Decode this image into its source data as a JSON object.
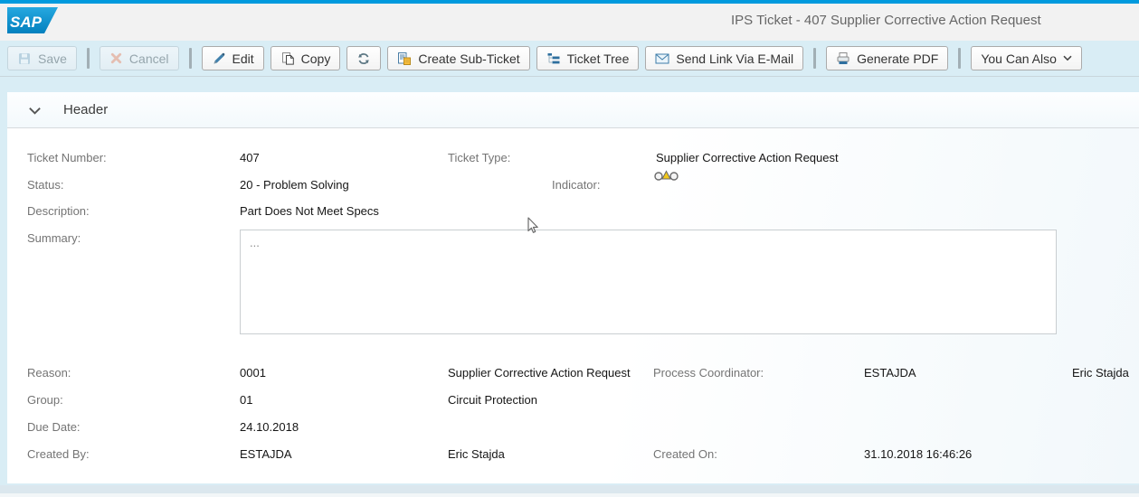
{
  "branding": {
    "logo_text": "SAP"
  },
  "titlebar": {
    "title": "IPS Ticket - 407 Supplier Corrective Action Request"
  },
  "toolbar": {
    "save": "Save",
    "cancel": "Cancel",
    "edit": "Edit",
    "copy": "Copy",
    "create_sub_ticket": "Create Sub-Ticket",
    "ticket_tree": "Ticket Tree",
    "send_link": "Send Link Via E-Mail",
    "generate_pdf": "Generate PDF",
    "you_can_also": "You Can Also"
  },
  "header_section": {
    "title": "Header",
    "fields": {
      "ticket_number": {
        "label": "Ticket Number:",
        "value": "407"
      },
      "ticket_type": {
        "label": "Ticket Type:",
        "value": "Supplier Corrective Action Request"
      },
      "status": {
        "label": "Status:",
        "value": "20 - Problem Solving"
      },
      "indicator": {
        "label": "Indicator:",
        "icon": "status-indicator-yellow-triangle"
      },
      "description": {
        "label": "Description:",
        "value": "Part Does Not Meet Specs"
      },
      "summary": {
        "label": "Summary:",
        "value": "..."
      },
      "reason": {
        "label": "Reason:",
        "code": "0001",
        "text": "Supplier Corrective Action Request"
      },
      "process_coordinator": {
        "label": "Process Coordinator:",
        "code": "ESTAJDA",
        "text": "Eric Stajda"
      },
      "group": {
        "label": "Group:",
        "code": "01",
        "text": "Circuit Protection"
      },
      "due_date": {
        "label": "Due Date:",
        "value": "24.10.2018"
      },
      "created_by": {
        "label": "Created By:",
        "code": "ESTAJDA",
        "text": "Eric Stajda"
      },
      "created_on": {
        "label": "Created On:",
        "value": "31.10.2018 16:46:26"
      }
    }
  },
  "colors": {
    "top_strip": "#009ade",
    "logo_blue": "#0d96d6",
    "toolbar_bg": "#d9edf5",
    "accent_blue": "#3d7ca9",
    "indicator_yellow": "#f3c818",
    "subticket_orange": "#f7bc3b"
  }
}
